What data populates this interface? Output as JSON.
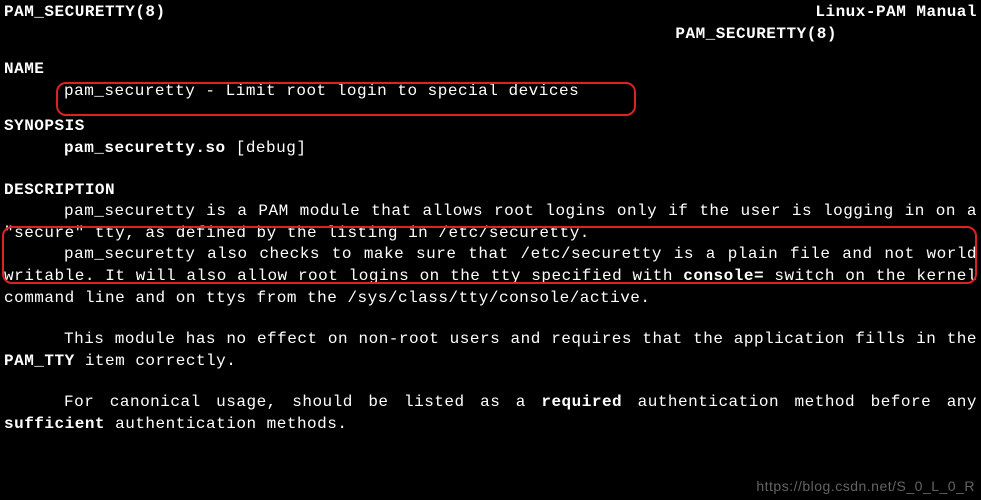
{
  "header": {
    "left": "PAM_SECURETTY(8)",
    "right": "Linux-PAM Manual",
    "sub": "PAM_SECURETTY(8)"
  },
  "sections": {
    "name": {
      "title": "NAME",
      "line": "pam_securetty - Limit root login to special devices"
    },
    "synopsis": {
      "title": "SYNOPSIS",
      "cmd": "pam_securetty.so",
      "args": " [debug]"
    },
    "description": {
      "title": "DESCRIPTION",
      "p1_a": "pam_securetty is a PAM module that allows root logins only if the user is logging in on a \"secure\" tty, as defined by the listing in /etc/securetty.",
      "p2_pre": "pam_securetty also checks to make sure that /etc/securetty is a plain file and not world writable. It will also allow root logins on the tty specified with ",
      "p2_bold": "console=",
      "p2_post": " switch on the kernel command line and on ttys from the /sys/class/tty/console/active.",
      "p3_pre": "This module has no effect on non-root users and requires that the application fills in the ",
      "p3_bold": "PAM_TTY",
      "p3_post": " item correctly.",
      "p4_pre": "For canonical usage, should be listed as a ",
      "p4_b1": "required",
      "p4_mid": " authentication method before any ",
      "p4_b2": "sufficient",
      "p4_post": " authentication methods."
    }
  },
  "watermark": "https://blog.csdn.net/S_0_L_0_R"
}
